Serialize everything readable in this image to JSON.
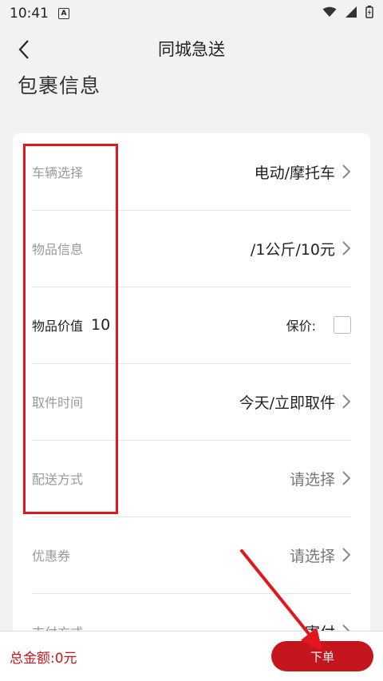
{
  "status_bar": {
    "time": "10:41",
    "app_badge": "A"
  },
  "header": {
    "title": "同城急送"
  },
  "section": {
    "title": "包裹信息"
  },
  "rows": [
    {
      "label": "车辆选择",
      "value": "电动/摩托车"
    },
    {
      "label": "物品信息",
      "value": "/1公斤/10元"
    },
    {
      "label": "物品价值",
      "value": "10",
      "insure_label": "保价:"
    },
    {
      "label": "取件时间",
      "value": "今天/立即取件"
    },
    {
      "label": "配送方式",
      "value": "请选择"
    },
    {
      "label": "优惠券",
      "value": "请选择"
    },
    {
      "label": "支付方式",
      "value": "寄付"
    }
  ],
  "footer": {
    "total": "总金额:0元",
    "order_button": "下单"
  },
  "colors": {
    "accent": "#c4161c",
    "highlight": "#e3161b"
  }
}
